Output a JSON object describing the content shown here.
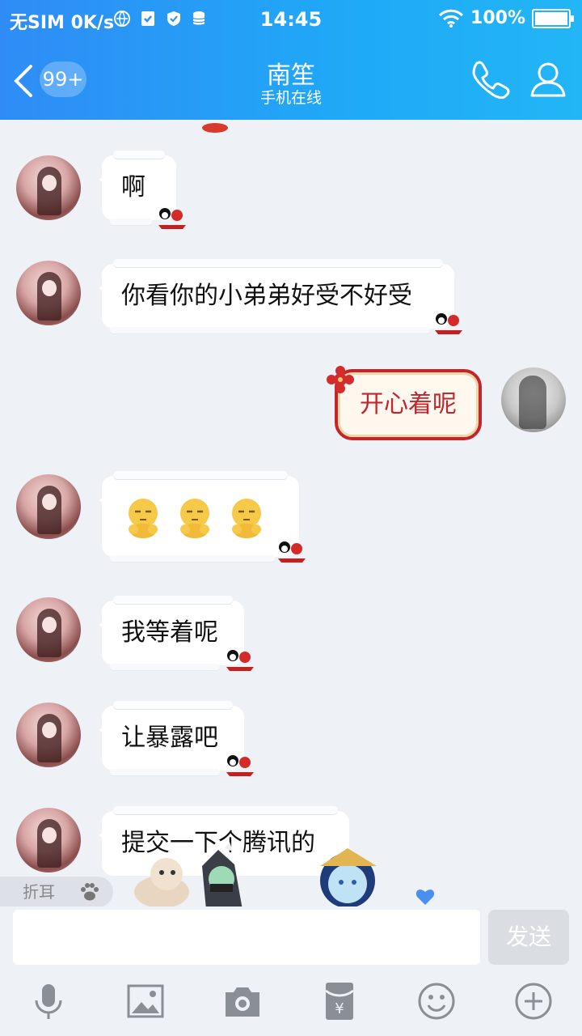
{
  "status_bar": {
    "carrier": "无SIM",
    "speed": "0K/s",
    "time": "14:45",
    "battery": "100%",
    "battery_level": 1.0
  },
  "header": {
    "unread_count": "99+",
    "contact_name": "南笙",
    "contact_status": "手机在线",
    "back_icon": "chevron-left-icon",
    "call_icon": "phone-icon",
    "profile_icon": "person-icon"
  },
  "messages": [
    {
      "side": "left",
      "text": "啊"
    },
    {
      "side": "left",
      "text": "你看你的小弟弟好受不好受"
    },
    {
      "side": "right",
      "text": "开心着呢"
    },
    {
      "side": "left",
      "emoji_count": 3,
      "emoji": "sleepy-face-emoji"
    },
    {
      "side": "left",
      "text": "我等着呢"
    },
    {
      "side": "left",
      "text": "让暴露吧"
    },
    {
      "side": "left",
      "text": "提交一下个腾讯的"
    }
  ],
  "fold_tab": {
    "label": "折耳"
  },
  "composer": {
    "input_value": "",
    "send_label": "发送"
  },
  "toolbar": [
    "microphone-icon",
    "image-icon",
    "camera-icon",
    "red-packet-icon",
    "emoji-icon",
    "plus-icon"
  ],
  "colors": {
    "header_start": "#2f8cf6",
    "header_end": "#22b6f6",
    "chat_bg": "#eef1f6",
    "my_bubble_border": "#c0262c"
  }
}
